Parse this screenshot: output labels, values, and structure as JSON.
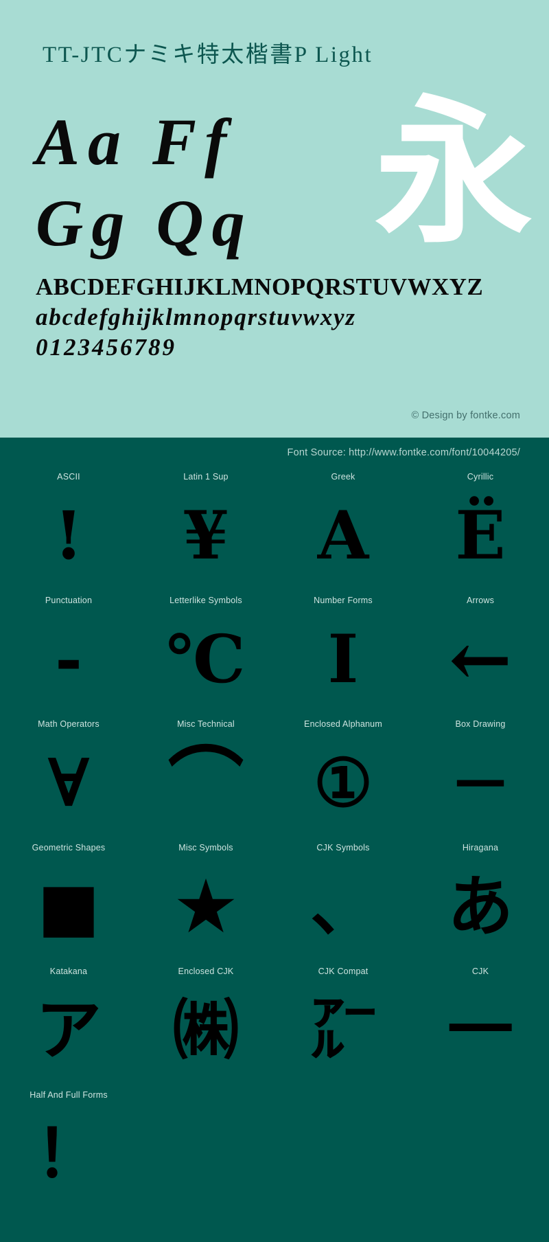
{
  "specimen": {
    "title": "TT-JTCナミキ特太楷書P Light",
    "sample_pairs": {
      "line1_left": "Aa",
      "line1_right": "Ff",
      "line2_left": "Gg",
      "line2_right": "Qq",
      "hero_glyph": "永"
    },
    "alphabet": {
      "uppercase": "ABCDEFGHIJKLMNOPQRSTUVWXYZ",
      "lowercase": "abcdefghijklmnopqrstuvwxyz",
      "digits": "0123456789"
    },
    "credit": "© Design by fontke.com",
    "font_source": "Font Source: http://www.fontke.com/font/10044205/"
  },
  "unicode_blocks": [
    [
      {
        "label": "ASCII",
        "glyph": "!",
        "size": "normal"
      },
      {
        "label": "Latin 1 Sup",
        "glyph": "¥",
        "size": "normal"
      },
      {
        "label": "Greek",
        "glyph": "Α",
        "size": "normal"
      },
      {
        "label": "Cyrillic",
        "glyph": "Ё",
        "size": "normal"
      }
    ],
    [
      {
        "label": "Punctuation",
        "glyph": "‐",
        "size": "normal"
      },
      {
        "label": "Letterlike Symbols",
        "glyph": "℃",
        "size": "normal"
      },
      {
        "label": "Number Forms",
        "glyph": "Ⅰ",
        "size": "normal"
      },
      {
        "label": "Arrows",
        "glyph": "←",
        "size": "wide"
      }
    ],
    [
      {
        "label": "Math Operators",
        "glyph": "∀",
        "size": "normal"
      },
      {
        "label": "Misc Technical",
        "glyph": "⌒",
        "size": "wide"
      },
      {
        "label": "Enclosed Alphanum",
        "glyph": "①",
        "size": "normal"
      },
      {
        "label": "Box Drawing",
        "glyph": "─",
        "size": "wide"
      }
    ],
    [
      {
        "label": "Geometric Shapes",
        "glyph": "■",
        "size": "normal"
      },
      {
        "label": "Misc Symbols",
        "glyph": "★",
        "size": "normal"
      },
      {
        "label": "CJK Symbols",
        "glyph": "、",
        "size": "normal"
      },
      {
        "label": "Hiragana",
        "glyph": "あ",
        "size": "normal"
      }
    ],
    [
      {
        "label": "Katakana",
        "glyph": "ア",
        "size": "normal"
      },
      {
        "label": "Enclosed CJK",
        "glyph": "㈱",
        "size": "normal"
      },
      {
        "label": "CJK Compat",
        "glyph": "㌃",
        "size": "normal"
      },
      {
        "label": "CJK",
        "glyph": "一",
        "size": "normal"
      }
    ],
    [
      {
        "label": "Half And Full Forms",
        "glyph": "！",
        "size": "normal"
      }
    ]
  ],
  "colors": {
    "top_background": "#a8dcd3",
    "bottom_background": "#00584f",
    "title_color": "#0c564f",
    "glyph_color": "#000000",
    "hero_glyph_color": "#ffffff",
    "label_color": "#cfe4e0",
    "credit_color": "#44706d"
  }
}
